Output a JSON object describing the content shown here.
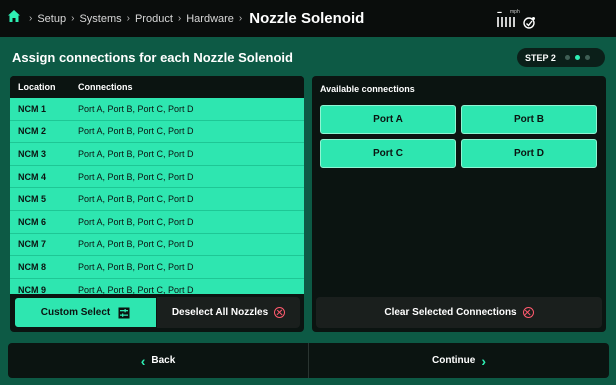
{
  "header": {
    "breadcrumbs": [
      "Setup",
      "Systems",
      "Product",
      "Hardware"
    ],
    "current": "Nozzle Solenoid",
    "speed": "--",
    "speed_unit": "mph"
  },
  "title": "Assign connections for each Nozzle Solenoid",
  "step": {
    "label": "STEP 2",
    "total": 3,
    "active_index": 1
  },
  "table": {
    "columns": [
      "Location",
      "Connections"
    ],
    "rows": [
      {
        "location": "NCM 1",
        "connections": "Port A, Port B, Port C, Port D"
      },
      {
        "location": "NCM 2",
        "connections": "Port A, Port B, Port C, Port D"
      },
      {
        "location": "NCM 3",
        "connections": "Port A, Port B, Port C, Port D"
      },
      {
        "location": "NCM 4",
        "connections": "Port A, Port B, Port C, Port D"
      },
      {
        "location": "NCM 5",
        "connections": "Port A, Port B, Port C, Port D"
      },
      {
        "location": "NCM 6",
        "connections": "Port A, Port B, Port C, Port D"
      },
      {
        "location": "NCM 7",
        "connections": "Port A, Port B, Port C, Port D"
      },
      {
        "location": "NCM 8",
        "connections": "Port A, Port B, Port C, Port D"
      },
      {
        "location": "NCM 9",
        "connections": "Port A, Port B, Port C, Port D"
      }
    ],
    "custom_select_label": "Custom Select",
    "deselect_all_label": "Deselect All Nozzles"
  },
  "available": {
    "title": "Available connections",
    "ports": [
      "Port A",
      "Port B",
      "Port C",
      "Port D"
    ],
    "clear_label": "Clear Selected Connections"
  },
  "footer": {
    "back_label": "Back",
    "continue_label": "Continue"
  },
  "colors": {
    "accent": "#2ee6b0",
    "background": "#0d5a45",
    "panel": "#0b1411",
    "danger": "#ff5a6e"
  }
}
